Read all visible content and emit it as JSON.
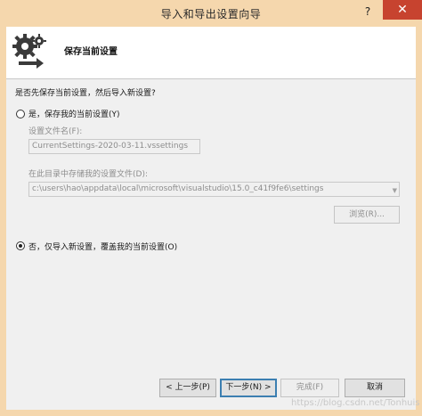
{
  "window": {
    "title": "导入和导出设置向导",
    "help_glyph": "?",
    "close_glyph": "✕"
  },
  "header": {
    "title": "保存当前设置",
    "icon": "gear-arrow-icon"
  },
  "question": "是否先保存当前设置，然后导入新设置?",
  "option_save": {
    "label": "是，保存我的当前设置(Y)",
    "selected": false,
    "filename_label": "设置文件名(F):",
    "filename_value": "CurrentSettings-2020-03-11.vssettings",
    "directory_label": "在此目录中存储我的设置文件(D):",
    "directory_value": "c:\\users\\hao\\appdata\\local\\microsoft\\visualstudio\\15.0_c41f9fe6\\settings",
    "browse_label": "浏览(R)..."
  },
  "option_overwrite": {
    "label": "否，仅导入新设置，覆盖我的当前设置(O)",
    "selected": true
  },
  "buttons": {
    "back": "< 上一步(P)",
    "next": "下一步(N) >",
    "finish": "完成(F)",
    "cancel": "取消"
  },
  "watermark": "https://blog.csdn.net/Tonhuis",
  "colors": {
    "title_bar": "#f5d7ad",
    "close_button": "#c7432f",
    "default_button_border": "#3c7fb1"
  }
}
